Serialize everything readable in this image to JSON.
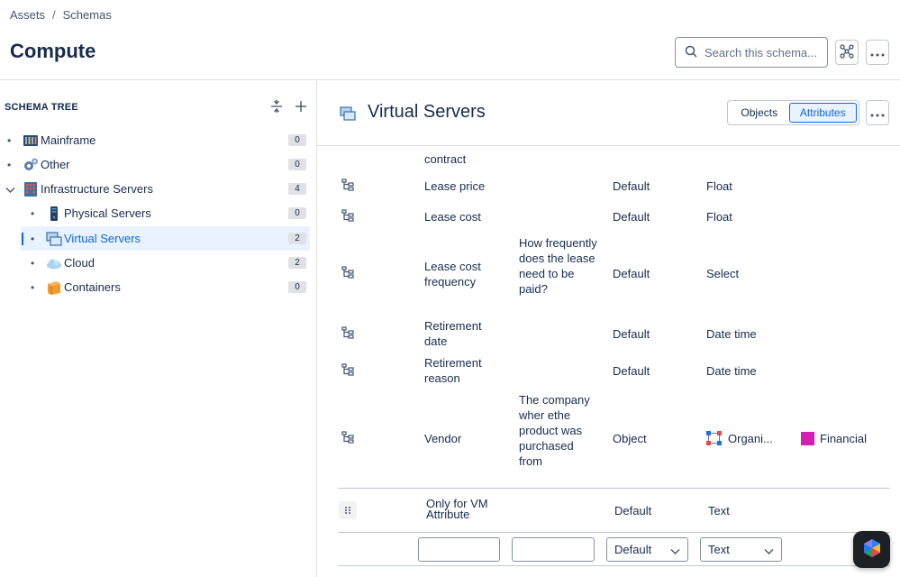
{
  "breadcrumb": {
    "items": [
      "Assets",
      "Schemas"
    ],
    "separator": "/"
  },
  "page_title": "Compute",
  "search": {
    "placeholder": "Search this schema..."
  },
  "tree": {
    "header": "SCHEMA TREE",
    "items": [
      {
        "label": "Mainframe",
        "count": "0",
        "icon": "mainframe-icon"
      },
      {
        "label": "Other",
        "count": "0",
        "icon": "gears-icon"
      },
      {
        "label": "Infrastructure Servers",
        "count": "4",
        "icon": "building-icon"
      },
      {
        "label": "Physical Servers",
        "count": "0",
        "icon": "server-icon"
      },
      {
        "label": "Virtual Servers",
        "count": "2",
        "icon": "virtual-servers-icon"
      },
      {
        "label": "Cloud",
        "count": "2",
        "icon": "cloud-icon"
      },
      {
        "label": "Containers",
        "count": "0",
        "icon": "container-icon"
      }
    ]
  },
  "panel": {
    "title": "Virtual Servers",
    "tabs": [
      "Objects",
      "Attributes"
    ],
    "active_tab": "Attributes"
  },
  "attributes": {
    "partial_row": "contract",
    "rows": [
      {
        "name": "Lease price",
        "description": "",
        "type": "Default",
        "value_type": "Float"
      },
      {
        "name": "Lease cost",
        "description": "",
        "type": "Default",
        "value_type": "Float"
      },
      {
        "name": "Lease cost frequency",
        "description": "How frequently does the lease need to be paid?",
        "type": "Default",
        "value_type": "Select"
      },
      {
        "name": "Retirement date",
        "description": "",
        "type": "Default",
        "value_type": "Date time"
      },
      {
        "name": "Retirement reason",
        "description": "",
        "type": "Default",
        "value_type": "Date time"
      },
      {
        "name": "Vendor",
        "description": "The company wher ethe product was purchased from",
        "type": "Object",
        "value_type": "Organi...",
        "extra": "Financial"
      }
    ],
    "vm_row": {
      "name": "Only for VM Attribute",
      "type": "Default",
      "value_type": "Text"
    }
  },
  "new_row": {
    "type_value": "Default",
    "value_type_value": "Text"
  },
  "colors": {
    "accent": "#0c66e4",
    "selected_bg": "#e9f2ff",
    "financial": "#d61fb1"
  }
}
